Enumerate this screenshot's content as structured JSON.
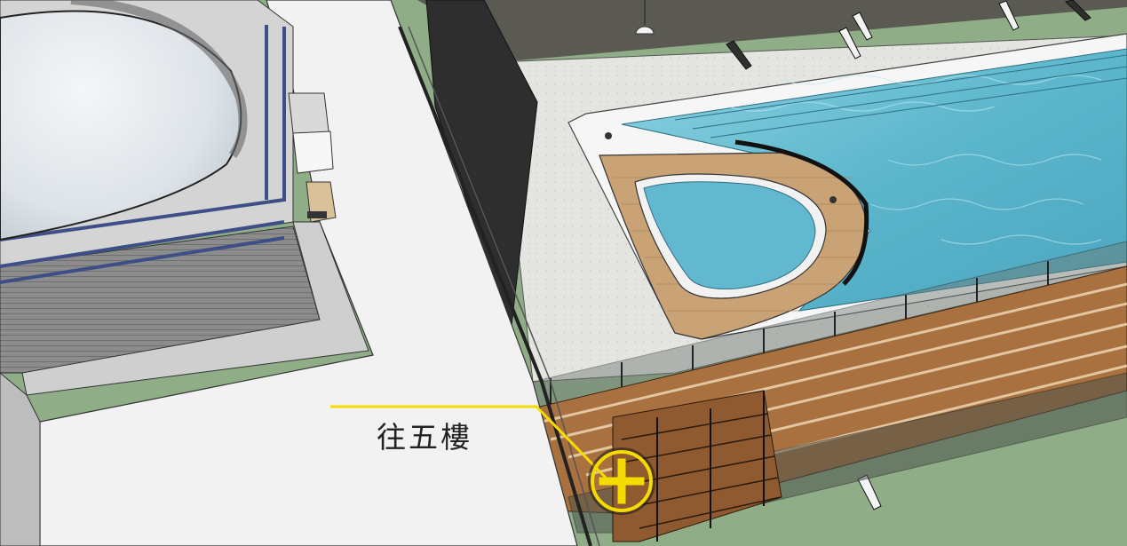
{
  "annotation": {
    "label": "往五樓",
    "marker_icon": "plus-circle-icon",
    "accent_color": "#f5dc00"
  },
  "scene": {
    "colors": {
      "lawn": "#8fad86",
      "floor_white": "#f2f2f2",
      "tile_grey": "#e3e3e0",
      "dark_wall": "#2e2e2e",
      "water": "#5fb8cf",
      "wood_deck": "#c79f6e",
      "wood_beam": "#a0683c",
      "glass_frame": "#3d4f86",
      "dome": "#e6ebee"
    }
  }
}
